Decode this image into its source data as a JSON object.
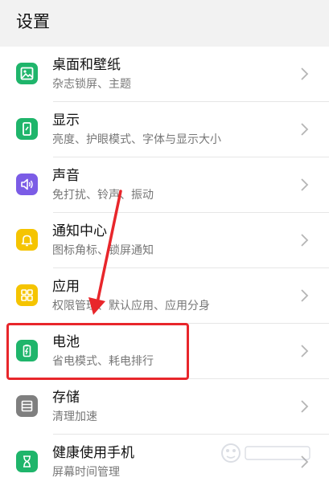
{
  "header": {
    "title": "设置"
  },
  "settings": {
    "items": [
      {
        "id": "wallpaper",
        "title": "桌面和壁纸",
        "subtitle": "杂志锁屏、主题",
        "icon": "image-icon",
        "color": "#1fb56b"
      },
      {
        "id": "display",
        "title": "显示",
        "subtitle": "亮度、护眼模式、字体与显示大小",
        "icon": "display-icon",
        "color": "#1fb56b"
      },
      {
        "id": "sound",
        "title": "声音",
        "subtitle": "免打扰、铃声、振动",
        "icon": "speaker-icon",
        "color": "#7b5ce6"
      },
      {
        "id": "notifications",
        "title": "通知中心",
        "subtitle": "图标角标、锁屏通知",
        "icon": "bell-icon",
        "color": "#f5c400"
      },
      {
        "id": "apps",
        "title": "应用",
        "subtitle": "权限管理、默认应用、应用分身",
        "icon": "apps-grid-icon",
        "color": "#f5c400"
      },
      {
        "id": "battery",
        "title": "电池",
        "subtitle": "省电模式、耗电排行",
        "icon": "battery-icon",
        "color": "#1fb56b"
      },
      {
        "id": "storage",
        "title": "存储",
        "subtitle": "清理加速",
        "icon": "storage-icon",
        "color": "#7f7f7f"
      },
      {
        "id": "digital-balance",
        "title": "健康使用手机",
        "subtitle": "屏幕时间管理",
        "icon": "hourglass-icon",
        "color": "#1fb56b"
      }
    ]
  },
  "colors": {
    "annotation": "#e8262b",
    "chevron": "#b5b5b5"
  }
}
